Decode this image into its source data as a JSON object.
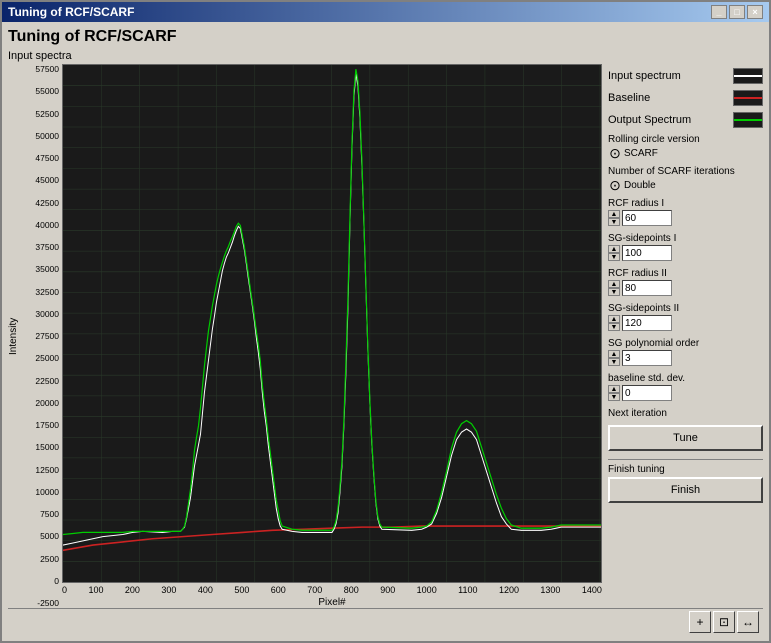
{
  "window": {
    "title": "Tuning of RCF/SCARF",
    "close_label": "×",
    "minimize_label": "_",
    "maximize_label": "□"
  },
  "page": {
    "title": "Tuning of RCF/SCARF"
  },
  "chart": {
    "input_spectra_label": "Input spectra",
    "y_axis_label": "Intensity",
    "x_axis_label": "Pixel#",
    "x_ticks": [
      "0",
      "100",
      "200",
      "300",
      "400",
      "500",
      "600",
      "700",
      "800",
      "900",
      "1000",
      "1100",
      "1200",
      "1300",
      "1400"
    ],
    "y_ticks": [
      "57500",
      "55000",
      "52500",
      "50000",
      "47500",
      "45000",
      "42500",
      "40000",
      "37500",
      "35000",
      "32500",
      "30000",
      "27500",
      "25000",
      "22500",
      "20000",
      "17500",
      "15000",
      "12500",
      "10000",
      "7500",
      "5000",
      "2500",
      "0",
      "-2500"
    ]
  },
  "legend": {
    "input_spectrum_label": "Input spectrum",
    "baseline_label": "Baseline",
    "output_spectrum_label": "Output Spectrum"
  },
  "controls": {
    "rolling_circle_label": "Rolling circle version",
    "rolling_circle_value": "SCARF",
    "scarf_iterations_label": "Number of SCARF iterations",
    "scarf_iterations_value": "Double",
    "rcf_radius_i_label": "RCF radius I",
    "rcf_radius_i_value": "60",
    "sg_sidepoints_i_label": "SG-sidepoints I",
    "sg_sidepoints_i_value": "100",
    "rcf_radius_ii_label": "RCF radius II",
    "rcf_radius_ii_value": "80",
    "sg_sidepoints_ii_label": "SG-sidepoints II",
    "sg_sidepoints_ii_value": "120",
    "sg_poly_order_label": "SG polynomial order",
    "sg_poly_order_value": "3",
    "baseline_std_label": "baseline std. dev.",
    "baseline_std_value": "0",
    "next_iteration_label": "Next iteration",
    "tune_label": "Tune",
    "finish_tuning_label": "Finish tuning",
    "finish_label": "Finish"
  },
  "toolbar": {
    "zoom_in_label": "+",
    "zoom_out_label": "⊡",
    "pan_label": "↔"
  }
}
